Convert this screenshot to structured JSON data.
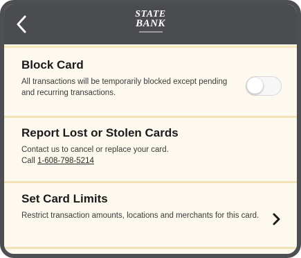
{
  "header": {
    "back_icon": "chevron-left-icon",
    "logo_line1": "STATE",
    "logo_line2": "BANK"
  },
  "block_card": {
    "title": "Block Card",
    "description": "All transactions will be temporarily blocked except pending and recurring transactions.",
    "toggle_state": "off"
  },
  "report_lost": {
    "title": "Report Lost or Stolen Cards",
    "description": "Contact us to cancel or replace your card.",
    "call_prefix": "Call",
    "phone": "1-608-798-5214"
  },
  "card_limits": {
    "title": "Set Card Limits",
    "description": "Restrict transaction amounts, locations and merchants for this card.",
    "chevron_icon": "chevron-right-icon"
  },
  "colors": {
    "header_bg": "#4a4c4f",
    "content_bg": "#fdf9ee",
    "divider": "#f2e3b6"
  }
}
